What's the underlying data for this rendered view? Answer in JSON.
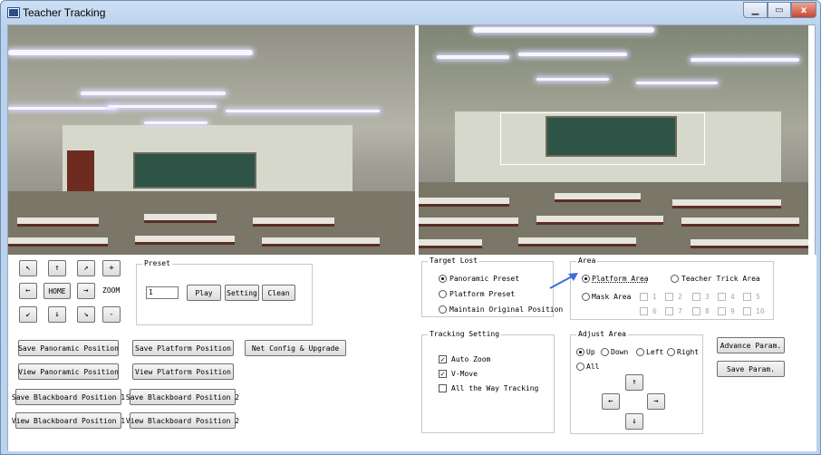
{
  "window": {
    "title": "Teacher Tracking",
    "close_label": "x"
  },
  "ptz": {
    "up_left": "↖",
    "up": "↑",
    "up_right": "↗",
    "zoom_in": "+",
    "left": "←",
    "home": "HOME",
    "right": "→",
    "zoom_label": "ZOOM",
    "down_left": "↙",
    "down": "↓",
    "down_right": "↘",
    "zoom_out": "-"
  },
  "preset": {
    "legend": "Preset",
    "value": "1",
    "play": "Play",
    "setting": "Setting",
    "clean": "Clean"
  },
  "buttons": {
    "save_panoramic": "Save Panoramic Position",
    "save_platform": "Save Platform Position",
    "net_config": "Net Config & Upgrade",
    "view_panoramic": "View Panoramic Position",
    "view_platform": "View Platform Position",
    "save_bb1": "Save Blackboard Position 1",
    "save_bb2": "Save Blackboard Position 2",
    "view_bb1": "View Blackboard Position 1",
    "view_bb2": "View Blackboard Position 2",
    "advance": "Advance Param.",
    "save_param": "Save Param."
  },
  "target_lost": {
    "legend": "Target Lost",
    "options": [
      "Panoramic Preset",
      "Platform Preset",
      "Maintain Original Position"
    ],
    "selected": 0
  },
  "tracking": {
    "legend": "Tracking Setting",
    "options": [
      {
        "label": "Auto Zoom",
        "checked": true
      },
      {
        "label": "V-Move",
        "checked": true
      },
      {
        "label": "All the Way Tracking",
        "checked": false
      }
    ]
  },
  "area": {
    "legend": "Area",
    "platform": "Platform Area",
    "trick": "Teacher Trick Area",
    "mask": "Mask Area",
    "mask_numbers": [
      "1",
      "2",
      "3",
      "4",
      "5",
      "6",
      "7",
      "8",
      "9",
      "10"
    ]
  },
  "adjust": {
    "legend": "Adjust Area",
    "options": [
      "Up",
      "Down",
      "Left",
      "Right",
      "All"
    ],
    "arrow_up": "↑",
    "arrow_left": "←",
    "arrow_right": "→",
    "arrow_down": "↓"
  }
}
